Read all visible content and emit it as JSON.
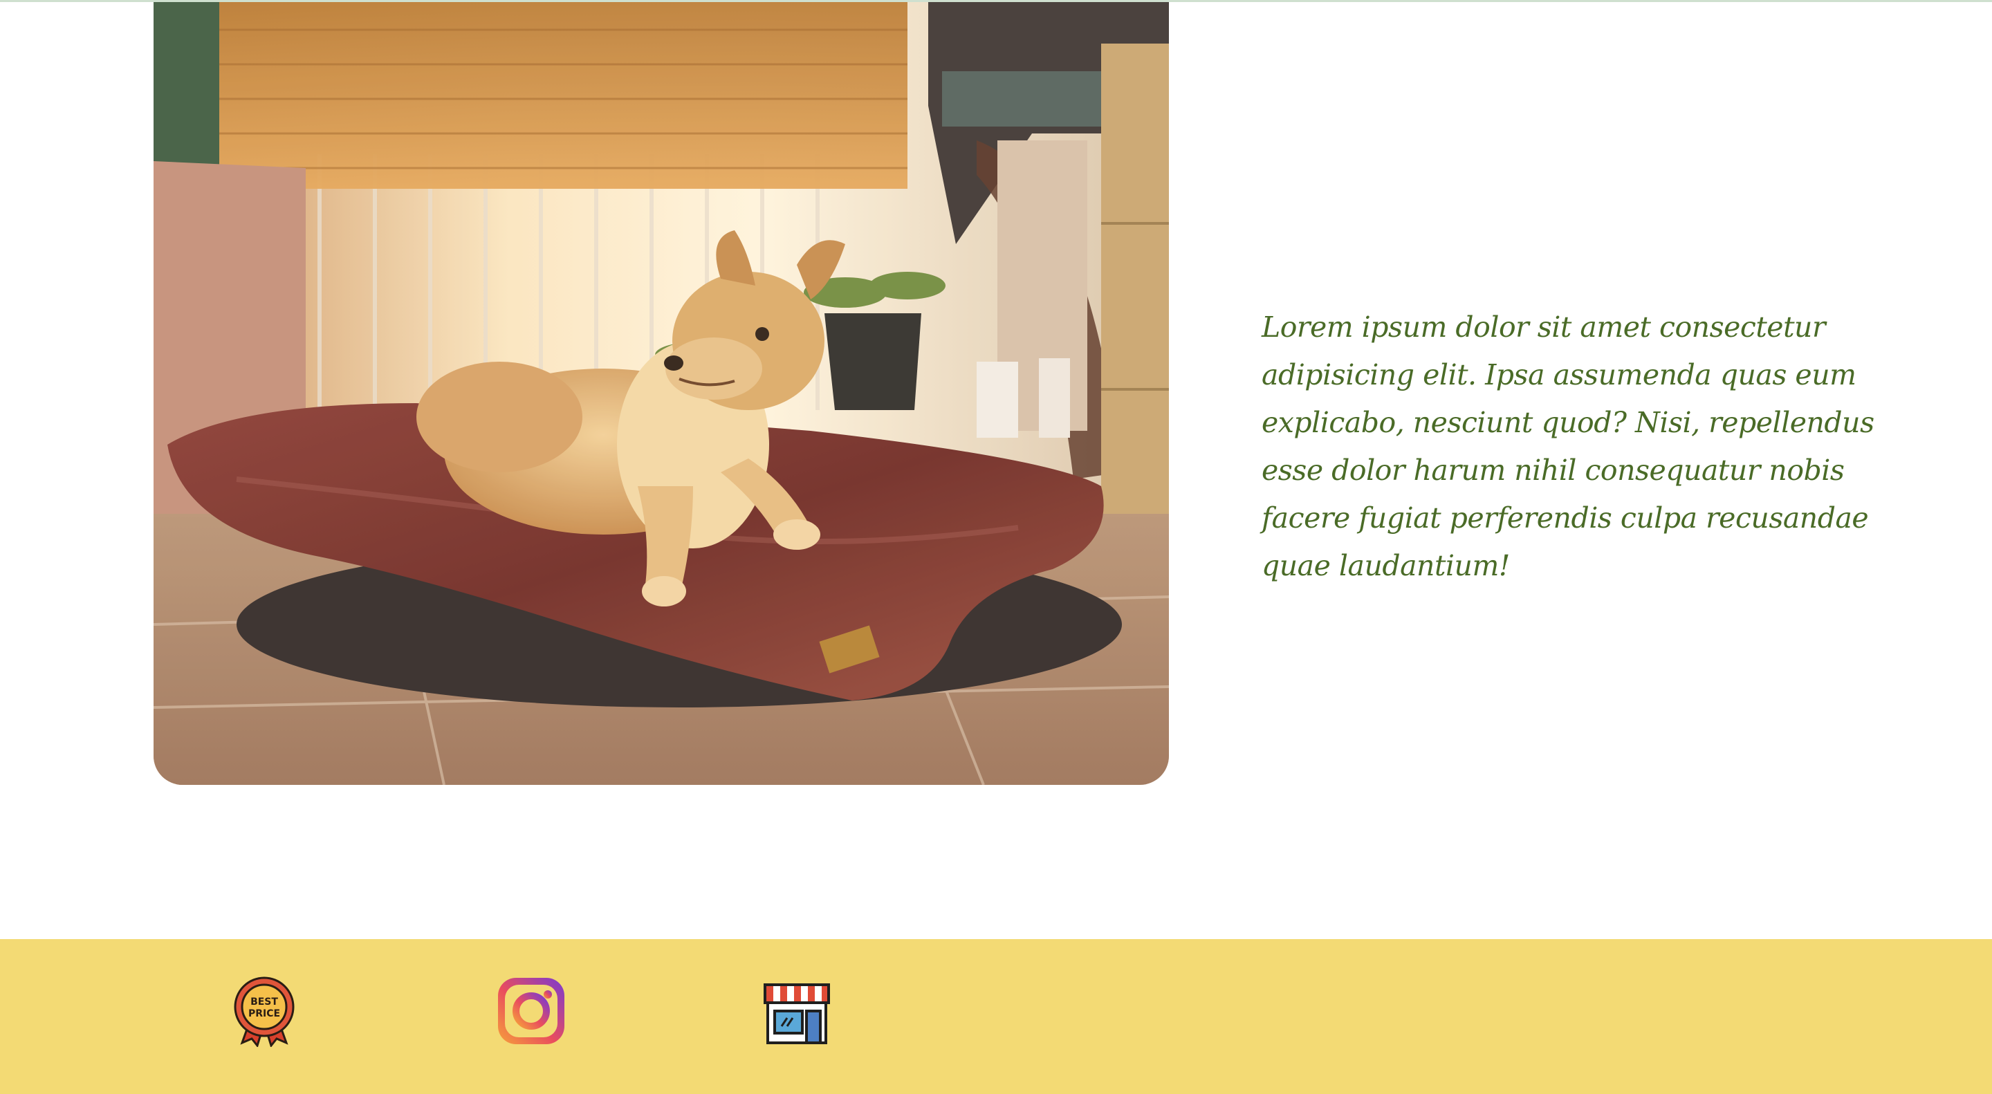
{
  "intro": {
    "text": "Lorem ipsum dolor sit amet consectetur adipisicing elit. Ipsa assumenda quas eum explicabo, nesciunt quod? Nisi, repellendus esse dolor harum nihil consequatur nobis facere fugiat perferendis culpa recusandae quae laudantium!"
  },
  "hero": {
    "subject": "dog-on-cushion-photo"
  },
  "footer": {
    "icons": [
      {
        "name": "best-price-badge-icon",
        "label": "BEST PRICE"
      },
      {
        "name": "instagram-icon"
      },
      {
        "name": "store-icon"
      }
    ]
  },
  "colors": {
    "script_text": "#4a6b27",
    "footer_bg": "#f3da74",
    "cushion": "#7a2c28"
  }
}
